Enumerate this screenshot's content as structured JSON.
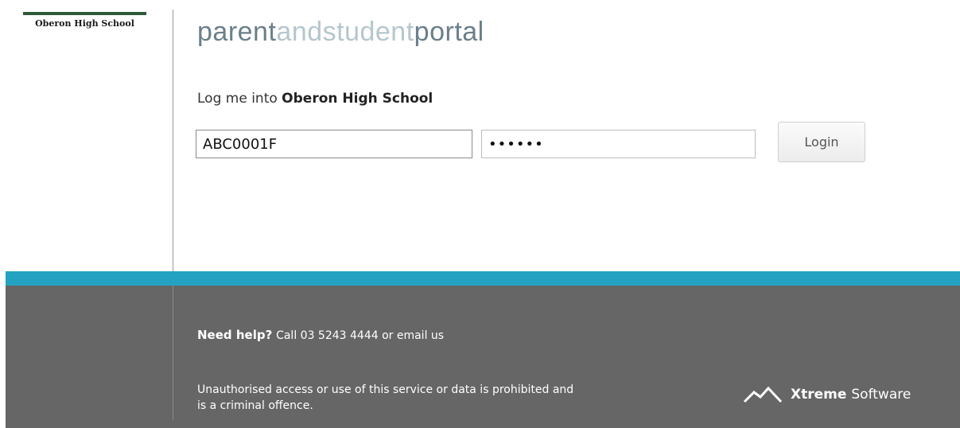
{
  "school_logo": {
    "name": "Oberon High School"
  },
  "portal_title": {
    "part1": "parent",
    "part2": "andstudent",
    "part3": "portal"
  },
  "login": {
    "prompt_prefix": "Log me into",
    "school_name": "Oberon High School",
    "username_value": "ABC0001F",
    "password_value": "••••••",
    "login_button": "Login"
  },
  "footer": {
    "help_label": "Need help?",
    "help_text": "Call 03 5243 4444 or email us",
    "legal_line1": "Unauthorised access or use of this service or data is prohibited and",
    "legal_line2": "is a criminal offence.",
    "brand_bold": "Xtreme",
    "brand_regular": "Software",
    "brand_icon": "mountain-icon"
  },
  "colors": {
    "stripe": "#23a3c1",
    "footer_bg": "#666666",
    "title_dark": "#6a7f8a",
    "title_light": "#b6c6ce"
  }
}
